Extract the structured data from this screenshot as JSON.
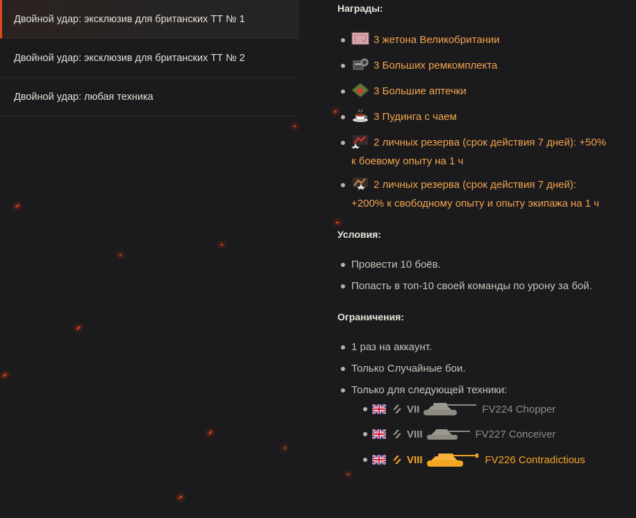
{
  "sidebar": {
    "items": [
      {
        "label": "Двойной удар: эксклюзив для британских ТТ № 1",
        "active": true
      },
      {
        "label": "Двойной удар: эксклюзив для британских ТТ № 2",
        "active": false
      },
      {
        "label": "Двойной удар: любая техника",
        "active": false
      }
    ]
  },
  "rewards": {
    "title": "Награды:",
    "items": [
      {
        "icon": "uk-token-icon",
        "text": "3 жетона Великобритании"
      },
      {
        "icon": "large-repair-kit-icon",
        "text": "3 Больших ремкомплекта"
      },
      {
        "icon": "large-first-aid-kit-icon",
        "text": "3 Большие аптечки"
      },
      {
        "icon": "pudding-tea-icon",
        "text": "3 Пудинга с чаем"
      },
      {
        "icon": "combat-xp-reserve-icon",
        "text_line1": "2 личных резерва (срок действия 7 дней): +50%",
        "text_line2": "к боевому опыту на 1 ч"
      },
      {
        "icon": "free-crew-xp-reserve-icon",
        "text_line1": "2 личных резерва (срок действия 7 дней):",
        "text_line2": "+200% к свободному опыту и опыту экипажа на 1 ч"
      }
    ]
  },
  "conditions": {
    "title": "Условия:",
    "items": [
      "Провести 10 боёв.",
      "Попасть в топ-10 своей команды по урону за бой."
    ]
  },
  "restrictions": {
    "title": "Ограничения:",
    "items": [
      "1 раз на аккаунт.",
      "Только Случайные бои.",
      "Только для следующей техники:"
    ],
    "vehicles": [
      {
        "tier": "VII",
        "name": "FV224 Chopper",
        "highlighted": false
      },
      {
        "tier": "VIII",
        "name": "FV227 Conceiver",
        "highlighted": false
      },
      {
        "tier": "VIII",
        "name": "FV226 Contradictious",
        "highlighted": true
      }
    ]
  },
  "colors": {
    "accent": "#e0491b",
    "reward_text": "#f4a44c",
    "highlight": "#f5a623",
    "background": "#1b1b1d"
  }
}
